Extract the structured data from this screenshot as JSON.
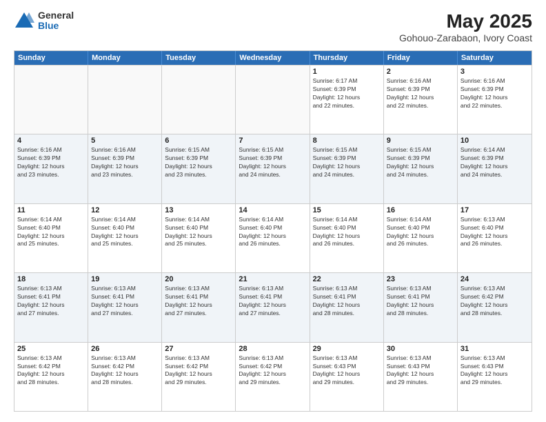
{
  "logo": {
    "general": "General",
    "blue": "Blue"
  },
  "title": "May 2025",
  "subtitle": "Gohouo-Zarabaon, Ivory Coast",
  "header_days": [
    "Sunday",
    "Monday",
    "Tuesday",
    "Wednesday",
    "Thursday",
    "Friday",
    "Saturday"
  ],
  "weeks": [
    [
      {
        "day": "",
        "text": ""
      },
      {
        "day": "",
        "text": ""
      },
      {
        "day": "",
        "text": ""
      },
      {
        "day": "",
        "text": ""
      },
      {
        "day": "1",
        "text": "Sunrise: 6:17 AM\nSunset: 6:39 PM\nDaylight: 12 hours\nand 22 minutes."
      },
      {
        "day": "2",
        "text": "Sunrise: 6:16 AM\nSunset: 6:39 PM\nDaylight: 12 hours\nand 22 minutes."
      },
      {
        "day": "3",
        "text": "Sunrise: 6:16 AM\nSunset: 6:39 PM\nDaylight: 12 hours\nand 22 minutes."
      }
    ],
    [
      {
        "day": "4",
        "text": "Sunrise: 6:16 AM\nSunset: 6:39 PM\nDaylight: 12 hours\nand 23 minutes."
      },
      {
        "day": "5",
        "text": "Sunrise: 6:16 AM\nSunset: 6:39 PM\nDaylight: 12 hours\nand 23 minutes."
      },
      {
        "day": "6",
        "text": "Sunrise: 6:15 AM\nSunset: 6:39 PM\nDaylight: 12 hours\nand 23 minutes."
      },
      {
        "day": "7",
        "text": "Sunrise: 6:15 AM\nSunset: 6:39 PM\nDaylight: 12 hours\nand 24 minutes."
      },
      {
        "day": "8",
        "text": "Sunrise: 6:15 AM\nSunset: 6:39 PM\nDaylight: 12 hours\nand 24 minutes."
      },
      {
        "day": "9",
        "text": "Sunrise: 6:15 AM\nSunset: 6:39 PM\nDaylight: 12 hours\nand 24 minutes."
      },
      {
        "day": "10",
        "text": "Sunrise: 6:14 AM\nSunset: 6:39 PM\nDaylight: 12 hours\nand 24 minutes."
      }
    ],
    [
      {
        "day": "11",
        "text": "Sunrise: 6:14 AM\nSunset: 6:40 PM\nDaylight: 12 hours\nand 25 minutes."
      },
      {
        "day": "12",
        "text": "Sunrise: 6:14 AM\nSunset: 6:40 PM\nDaylight: 12 hours\nand 25 minutes."
      },
      {
        "day": "13",
        "text": "Sunrise: 6:14 AM\nSunset: 6:40 PM\nDaylight: 12 hours\nand 25 minutes."
      },
      {
        "day": "14",
        "text": "Sunrise: 6:14 AM\nSunset: 6:40 PM\nDaylight: 12 hours\nand 26 minutes."
      },
      {
        "day": "15",
        "text": "Sunrise: 6:14 AM\nSunset: 6:40 PM\nDaylight: 12 hours\nand 26 minutes."
      },
      {
        "day": "16",
        "text": "Sunrise: 6:14 AM\nSunset: 6:40 PM\nDaylight: 12 hours\nand 26 minutes."
      },
      {
        "day": "17",
        "text": "Sunrise: 6:13 AM\nSunset: 6:40 PM\nDaylight: 12 hours\nand 26 minutes."
      }
    ],
    [
      {
        "day": "18",
        "text": "Sunrise: 6:13 AM\nSunset: 6:41 PM\nDaylight: 12 hours\nand 27 minutes."
      },
      {
        "day": "19",
        "text": "Sunrise: 6:13 AM\nSunset: 6:41 PM\nDaylight: 12 hours\nand 27 minutes."
      },
      {
        "day": "20",
        "text": "Sunrise: 6:13 AM\nSunset: 6:41 PM\nDaylight: 12 hours\nand 27 minutes."
      },
      {
        "day": "21",
        "text": "Sunrise: 6:13 AM\nSunset: 6:41 PM\nDaylight: 12 hours\nand 27 minutes."
      },
      {
        "day": "22",
        "text": "Sunrise: 6:13 AM\nSunset: 6:41 PM\nDaylight: 12 hours\nand 28 minutes."
      },
      {
        "day": "23",
        "text": "Sunrise: 6:13 AM\nSunset: 6:41 PM\nDaylight: 12 hours\nand 28 minutes."
      },
      {
        "day": "24",
        "text": "Sunrise: 6:13 AM\nSunset: 6:42 PM\nDaylight: 12 hours\nand 28 minutes."
      }
    ],
    [
      {
        "day": "25",
        "text": "Sunrise: 6:13 AM\nSunset: 6:42 PM\nDaylight: 12 hours\nand 28 minutes."
      },
      {
        "day": "26",
        "text": "Sunrise: 6:13 AM\nSunset: 6:42 PM\nDaylight: 12 hours\nand 28 minutes."
      },
      {
        "day": "27",
        "text": "Sunrise: 6:13 AM\nSunset: 6:42 PM\nDaylight: 12 hours\nand 29 minutes."
      },
      {
        "day": "28",
        "text": "Sunrise: 6:13 AM\nSunset: 6:42 PM\nDaylight: 12 hours\nand 29 minutes."
      },
      {
        "day": "29",
        "text": "Sunrise: 6:13 AM\nSunset: 6:43 PM\nDaylight: 12 hours\nand 29 minutes."
      },
      {
        "day": "30",
        "text": "Sunrise: 6:13 AM\nSunset: 6:43 PM\nDaylight: 12 hours\nand 29 minutes."
      },
      {
        "day": "31",
        "text": "Sunrise: 6:13 AM\nSunset: 6:43 PM\nDaylight: 12 hours\nand 29 minutes."
      }
    ]
  ]
}
